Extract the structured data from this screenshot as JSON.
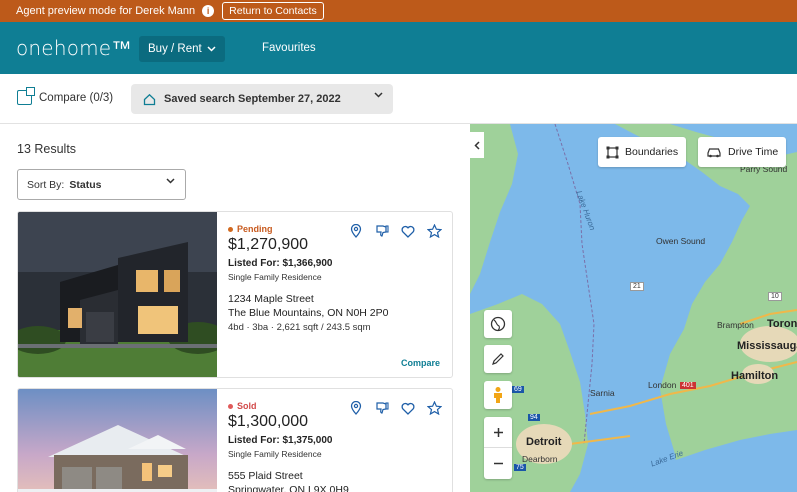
{
  "agent_bar": {
    "text": "Agent preview mode for Derek Mann",
    "info_icon": "i",
    "return_label": "Return to Contacts"
  },
  "nav": {
    "logo": "onehome™",
    "buy_rent": "Buy / Rent",
    "favourites": "Favourites"
  },
  "toolbar": {
    "compare": "Compare (0/3)",
    "saved_search": "Saved search September 27, 2022"
  },
  "results": {
    "count": "13 Results",
    "sort_label": "Sort By:",
    "sort_value": "Status"
  },
  "listings": [
    {
      "status": "Pending",
      "status_color": "#d2691e",
      "price": "$1,270,900",
      "listed_for": "Listed For: $1,366,900",
      "type": "Single Family Residence",
      "street": "1234 Maple Street",
      "city": "The Blue Mountains, ON N0H 2P0",
      "specs": "4bd · 3ba · 2,621 sqft / 243.5 sqm",
      "compare": "Compare"
    },
    {
      "status": "Sold",
      "status_color": "#e05a5a",
      "price": "$1,300,000",
      "listed_for": "Listed For: $1,375,000",
      "type": "Single Family Residence",
      "street": "555 Plaid Street",
      "city": "Springwater, ON L9X 0H9"
    }
  ],
  "map": {
    "boundaries": "Boundaries",
    "drive_time": "Drive Time",
    "labels": {
      "parry_sound": "Parry Sound",
      "owen_sound": "Owen Sound",
      "brampton": "Brampton",
      "toronto": "Toron",
      "mississauga": "Mississauga",
      "hamilton": "Hamilton",
      "london": "London",
      "sarnia": "Sarnia",
      "detroit": "Detroit",
      "dearborn": "Dearborn",
      "lake_huron": "Lake Huron",
      "lake_erie": "Lake Erie",
      "hwy_401": "401",
      "hwy_21": "21",
      "hwy_10": "10",
      "hwy_75": "75",
      "hwy_94": "94",
      "hwy_69": "69"
    }
  },
  "colors": {
    "agent_bar": "#bd5a1a",
    "nav": "#0f7e94",
    "accent": "#0f7e94"
  }
}
